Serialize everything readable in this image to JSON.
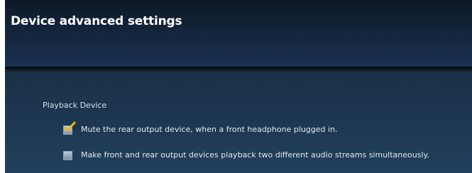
{
  "dialog": {
    "title": "Device advanced settings"
  },
  "playback": {
    "section_label": "Playback Device",
    "options": [
      {
        "label": "Mute the rear output device, when a front headphone plugged in.",
        "checked": true
      },
      {
        "label": "Make front and rear output devices playback two different audio streams simultaneously.",
        "checked": false
      }
    ]
  },
  "colors": {
    "header_bg": "#13243a",
    "body_bg": "#1e3953",
    "text": "#e2eaf2",
    "check_accent": "#f2b21c"
  }
}
